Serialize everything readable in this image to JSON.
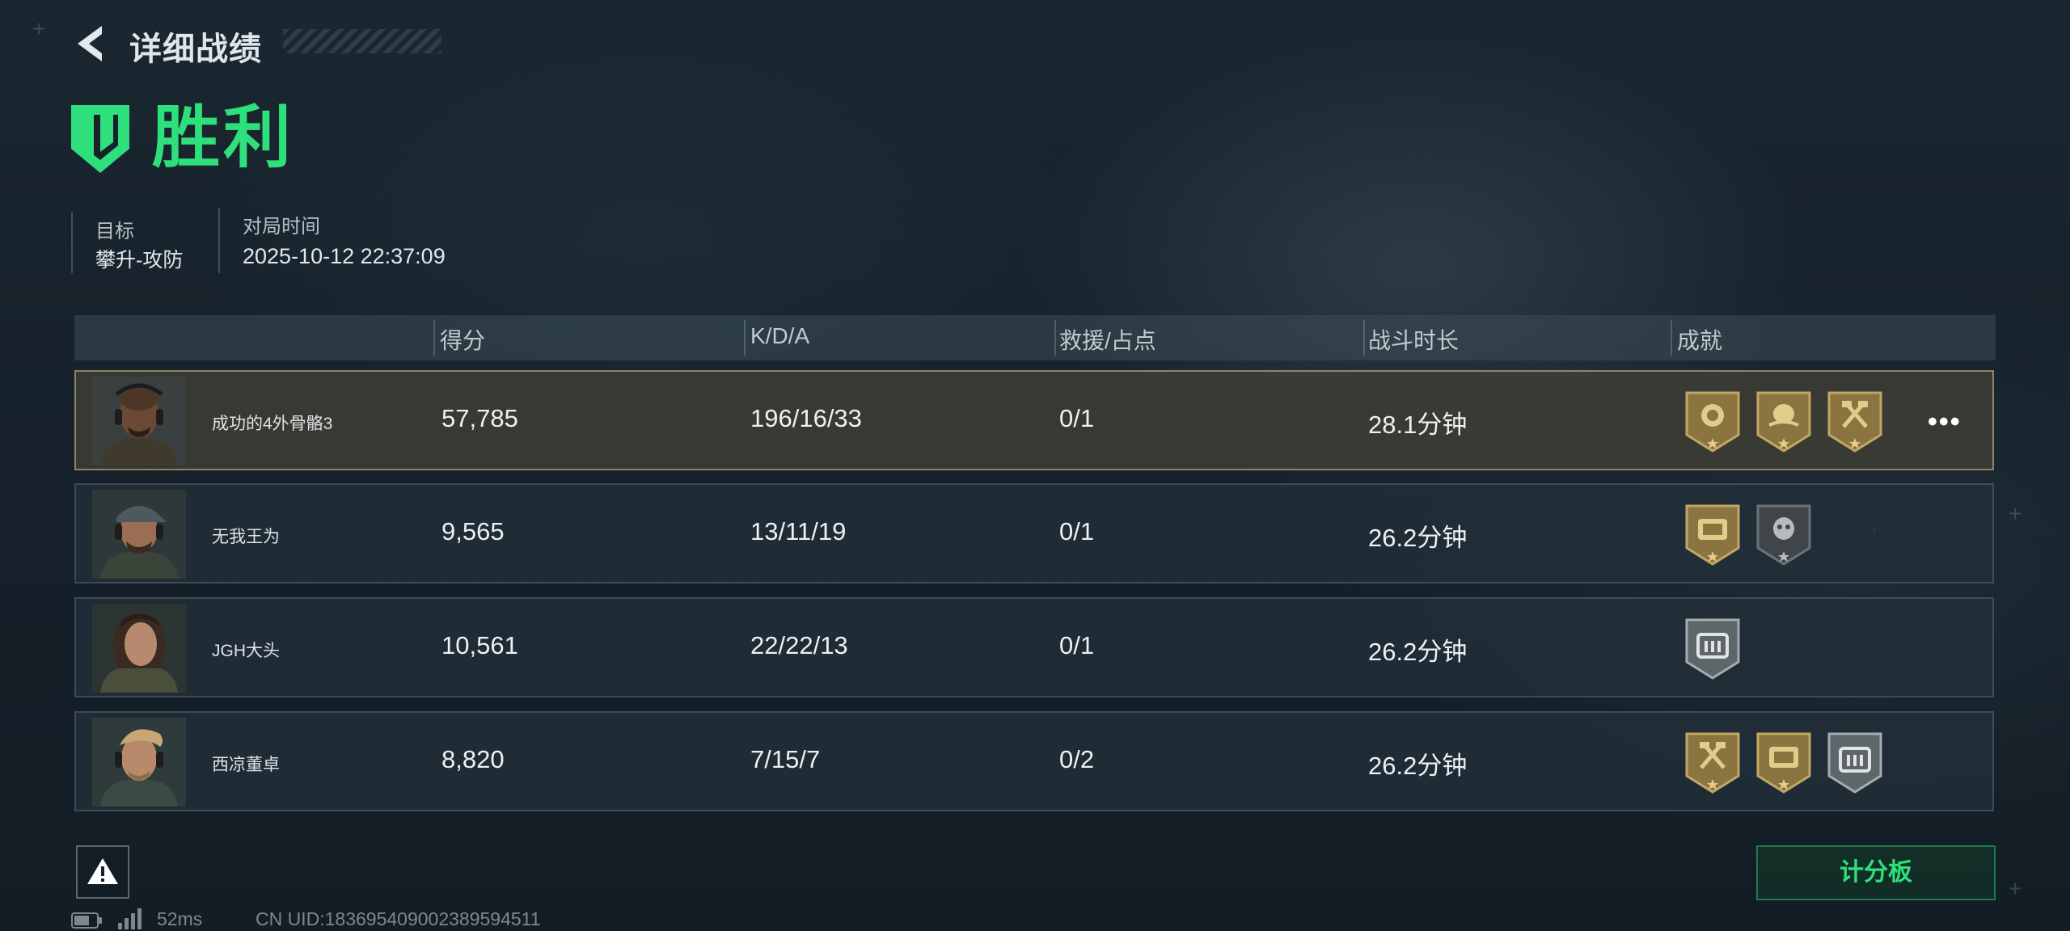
{
  "header": {
    "title": "详细战绩"
  },
  "result": {
    "label": "胜利",
    "accent": "#2ee07c"
  },
  "info": {
    "objective_label": "目标",
    "objective_value": "攀升-攻防",
    "time_label": "对局时间",
    "time_value": "2025-10-12 22:37:09"
  },
  "table": {
    "columns": [
      "得分",
      "K/D/A",
      "救援/占点",
      "战斗时长",
      "成就"
    ],
    "rows": [
      {
        "name": "成功的4外骨骼3",
        "score": "57,785",
        "kda": "196/16/33",
        "rescue": "0/1",
        "duration": "28.1分钟",
        "badges": [
          "gold",
          "gold",
          "gold"
        ],
        "highlight": true
      },
      {
        "name": "无我王为",
        "score": "9,565",
        "kda": "13/11/19",
        "rescue": "0/1",
        "duration": "26.2分钟",
        "badges": [
          "gold",
          "grey"
        ]
      },
      {
        "name": "JGH大头",
        "score": "10,561",
        "kda": "22/22/13",
        "rescue": "0/1",
        "duration": "26.2分钟",
        "badges": [
          "silver"
        ]
      },
      {
        "name": "西凉董卓",
        "score": "8,820",
        "kda": "7/15/7",
        "rescue": "0/2",
        "duration": "26.2分钟",
        "badges": [
          "gold",
          "gold",
          "silver"
        ]
      }
    ]
  },
  "footer": {
    "scoreboard_label": "计分板",
    "ping": "52ms",
    "uid": "CN UID:1836954090023895945​11"
  },
  "icons": {
    "back": "chevron-left-icon",
    "result": "shield-icon",
    "warning": "warning-icon",
    "more": "more-dots-icon"
  }
}
